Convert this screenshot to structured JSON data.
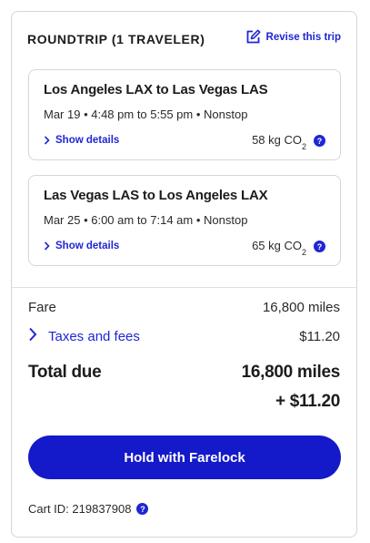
{
  "header": {
    "trip_type": "ROUNDTRIP (1 TRAVELER)",
    "revise_label": "Revise this trip"
  },
  "flights": [
    {
      "route": "Los Angeles LAX to Las Vegas LAS",
      "times": "Mar 19 • 4:48 pm to 5:55 pm • Nonstop",
      "details_label": "Show details",
      "co2_value": "58 kg CO",
      "co2_sub": "2"
    },
    {
      "route": "Las Vegas LAS to Los Angeles LAX",
      "times": "Mar 25 • 6:00 am to 7:14 am • Nonstop",
      "details_label": "Show details",
      "co2_value": "65 kg CO",
      "co2_sub": "2"
    }
  ],
  "summary": {
    "fare_label": "Fare",
    "fare_value": "16,800 miles",
    "taxes_label": "Taxes and fees",
    "taxes_value": "$11.20",
    "total_label": "Total due",
    "total_miles": "16,800 miles",
    "total_cash": "+ $11.20"
  },
  "hold_button_label": "Hold with Farelock",
  "cart": {
    "label": "Cart ID: 219837908"
  },
  "icons": {
    "info": "?",
    "edit": "edit-icon",
    "chevron": "chevron-right-icon"
  },
  "colors": {
    "accent": "#1f26d4",
    "button": "#1419c9",
    "border": "#d6d6d6"
  }
}
